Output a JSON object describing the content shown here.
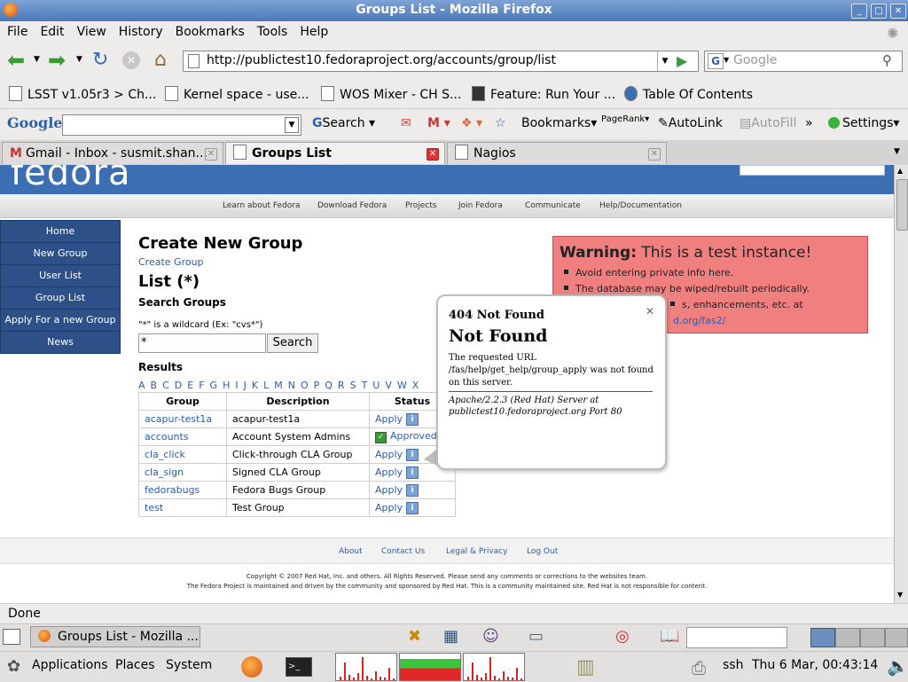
{
  "window": {
    "title": "Groups List - Mozilla Firefox"
  },
  "menubar": [
    "File",
    "Edit",
    "View",
    "History",
    "Bookmarks",
    "Tools",
    "Help"
  ],
  "nav": {
    "url": "http://publictest10.fedoraproject.org/accounts/group/list",
    "search_placeholder": "Google"
  },
  "bookmarks": [
    "LSST v1.05r3 > Ch...",
    "Kernel space - use...",
    "WOS Mixer - CH S...",
    "Feature: Run Your ...",
    "Table Of Contents"
  ],
  "googlebar": {
    "logo": "Google",
    "search": "Search",
    "bookmarks": "Bookmarks",
    "pagerank": "PageRank",
    "autolink": "AutoLink",
    "autofill": "AutoFill",
    "more": "»",
    "settings": "Settings"
  },
  "tabs": [
    {
      "label": "Gmail - Inbox - susmit.shan..."
    },
    {
      "label": "Groups List"
    },
    {
      "label": "Nagios"
    }
  ],
  "page": {
    "logo": "fedora",
    "subnav": [
      "Learn about Fedora",
      "Download Fedora",
      "Projects",
      "Join Fedora",
      "Communicate",
      "Help/Documentation"
    ],
    "leftnav": [
      "Home",
      "New Group",
      "User List",
      "Group List",
      "Apply For a new Group",
      "News"
    ],
    "heading": "Create New Group",
    "create_link": "Create Group",
    "list_heading": "List (*)",
    "search_heading": "Search Groups",
    "wildcard_hint": "\"*\" is a wildcard (Ex: \"cvs*\")",
    "search_value": "*",
    "search_button": "Search",
    "results_heading": "Results",
    "letters": [
      "A",
      "B",
      "C",
      "D",
      "E",
      "F",
      "G",
      "H",
      "I",
      "J",
      "K",
      "L",
      "M",
      "N",
      "O",
      "P",
      "Q",
      "R",
      "S",
      "T",
      "U",
      "V",
      "W",
      "X"
    ],
    "table_headers": [
      "Group",
      "Description",
      "Status"
    ],
    "rows": [
      {
        "group": "acapur-test1a",
        "desc": "acapur-test1a",
        "status": "Apply"
      },
      {
        "group": "accounts",
        "desc": "Account System Admins",
        "status": "Approved"
      },
      {
        "group": "cla_click",
        "desc": "Click-through CLA Group",
        "status": "Apply"
      },
      {
        "group": "cla_sign",
        "desc": "Signed CLA Group",
        "status": "Apply"
      },
      {
        "group": "fedorabugs",
        "desc": "Fedora Bugs Group",
        "status": "Apply"
      },
      {
        "group": "test",
        "desc": "Test Group",
        "status": "Apply"
      }
    ],
    "warning": {
      "label": "Warning:",
      "text": "This is a test instance!",
      "items": [
        "Avoid entering private info here.",
        "The database may be wiped/rebuilt periodically.",
        "s, enhancements, etc. at",
        "d.org/fas2/"
      ]
    },
    "popup": {
      "title": "404 Not Found",
      "heading": "Not Found",
      "body": "The requested URL /fas/help/get_help/group_apply was not found on this server.",
      "footer": "Apache/2.2.3 (Red Hat) Server at publictest10.fedoraproject.org Port 80"
    },
    "footer_links": [
      "About",
      "Contact Us",
      "Legal & Privacy",
      "Log Out"
    ],
    "copyright1": "Copyright © 2007 Red Hat, Inc. and others. All Rights Reserved. Please send any comments or corrections to the websites team.",
    "copyright2": "The Fedora Project is maintained and driven by the community and sponsored by Red Hat. This is a community maintained site. Red Hat is not responsible for content."
  },
  "status": "Done",
  "taskbar": {
    "window": "Groups List - Mozilla ..."
  },
  "panel": {
    "applications": "Applications",
    "places": "Places",
    "system": "System",
    "ssh": "ssh",
    "clock": "Thu  6 Mar, 00:43:14"
  }
}
